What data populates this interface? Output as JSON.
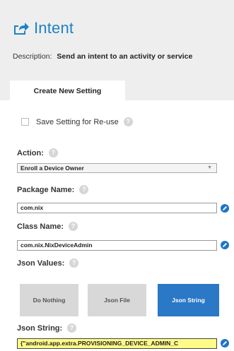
{
  "header": {
    "title": "Intent",
    "title_icon": "share-arrow-icon",
    "description_label": "Description:",
    "description_value": "Send an intent to an activity or service"
  },
  "tabs": [
    {
      "label": "Create New Setting",
      "active": true
    }
  ],
  "save_setting": {
    "label": "Save Setting for Re-use",
    "checked": false
  },
  "action": {
    "label": "Action:",
    "selected": "Enroll a Device Owner"
  },
  "package_name": {
    "label": "Package Name:",
    "value": "com.nix"
  },
  "class_name": {
    "label": "Class Name:",
    "value": "com.nix.NixDeviceAdmin"
  },
  "json_values": {
    "label": "Json Values:",
    "buttons": [
      {
        "label": "Do Nothing",
        "selected": false
      },
      {
        "label": "Json File",
        "selected": false
      },
      {
        "label": "Json String",
        "selected": true
      }
    ]
  },
  "json_string": {
    "label": "Json String:",
    "value": "{\"android.app.extra.PROVISIONING_DEVICE_ADMIN_C"
  },
  "help_icon_glyph": "?",
  "colors": {
    "accent": "#1c82c4",
    "selected_button": "#2a78c6",
    "highlight": "#fffb88"
  }
}
